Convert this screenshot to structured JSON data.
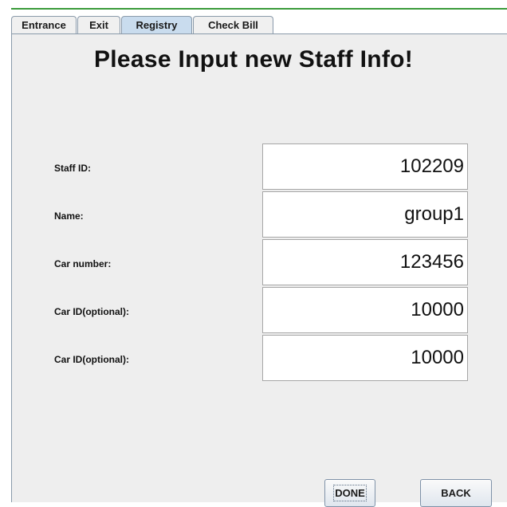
{
  "tabs": [
    {
      "label": "Entrance"
    },
    {
      "label": "Exit"
    },
    {
      "label": "Registry",
      "selected": true
    },
    {
      "label": "Check Bill"
    }
  ],
  "title": "Please Input new Staff Info!",
  "fields": [
    {
      "label": "Staff ID:",
      "value": "102209"
    },
    {
      "label": "Name:",
      "value": "group1"
    },
    {
      "label": "Car number:",
      "value": "123456"
    },
    {
      "label": "Car ID(optional):",
      "value": "10000"
    },
    {
      "label": "Car ID(optional):",
      "value": "10000"
    }
  ],
  "buttons": {
    "done": "DONE",
    "back": "BACK"
  },
  "colors": {
    "selected_tab": "#c9dcee",
    "panel_background": "#eeeeee",
    "top_accent_line": "#3a9a3a"
  }
}
